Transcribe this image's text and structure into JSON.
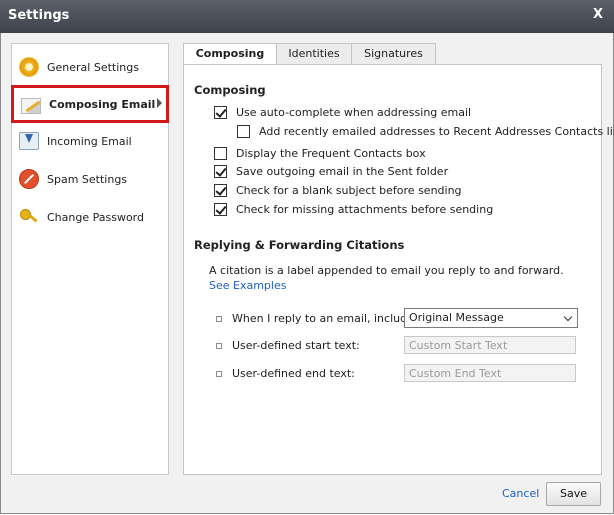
{
  "window": {
    "title": "Settings",
    "close_label": "X"
  },
  "sidebar": {
    "items": [
      {
        "label": "General Settings",
        "icon": "gear-icon"
      },
      {
        "label": "Composing Email",
        "icon": "compose-icon",
        "selected": true
      },
      {
        "label": "Incoming Email",
        "icon": "inbox-icon"
      },
      {
        "label": "Spam Settings",
        "icon": "spam-icon"
      },
      {
        "label": "Change Password",
        "icon": "key-icon"
      }
    ]
  },
  "tabs": [
    {
      "label": "Composing",
      "active": true
    },
    {
      "label": "Identities"
    },
    {
      "label": "Signatures"
    }
  ],
  "composing": {
    "heading": "Composing",
    "options": [
      {
        "label": "Use auto-complete when addressing email",
        "checked": true
      },
      {
        "label": "Add recently emailed addresses to Recent Addresses Contacts list",
        "checked": false
      },
      {
        "label": "Display the Frequent Contacts box",
        "checked": false
      },
      {
        "label": "Save outgoing email in the Sent folder",
        "checked": true
      },
      {
        "label": "Check for a blank subject before sending",
        "checked": true
      },
      {
        "label": "Check for missing attachments before sending",
        "checked": true
      }
    ]
  },
  "citations": {
    "heading": "Replying & Forwarding Citations",
    "description": "A citation is a label appended to email you reply to and forward.",
    "see_examples": "See Examples",
    "reply_include_label": "When I reply to an email, include:",
    "reply_include_value": "Original Message",
    "start_text_label": "User-defined start text:",
    "start_text_placeholder": "Custom Start Text",
    "end_text_label": "User-defined end text:",
    "end_text_placeholder": "Custom End Text"
  },
  "footer": {
    "cancel_label": "Cancel",
    "save_label": "Save"
  },
  "colors": {
    "selected_border": "#d21a1a",
    "link": "#1f5fbf",
    "titlebar": "#4a4e55"
  }
}
